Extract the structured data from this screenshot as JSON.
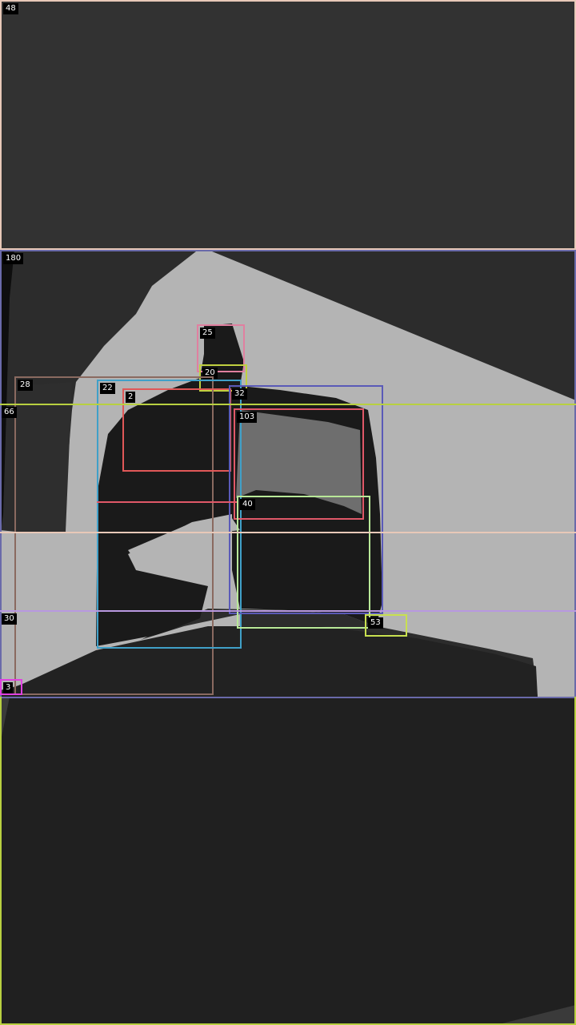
{
  "regions": [
    {
      "id": "48",
      "label": "48",
      "color": "#e8c8b8"
    },
    {
      "id": "180",
      "label": "180",
      "color": "#6a6aaa"
    },
    {
      "id": "25",
      "label": "25",
      "color": "#e080a0"
    },
    {
      "id": "20",
      "label": "20",
      "color": "#c0d040"
    },
    {
      "id": "28",
      "label": "28",
      "color": "#8a6a60"
    },
    {
      "id": "22",
      "label": "22",
      "color": "#40a0c8"
    },
    {
      "id": "2",
      "label": "2",
      "color": "#e05858"
    },
    {
      "id": "32",
      "label": "32",
      "color": "#5a5ab8"
    },
    {
      "id": "103",
      "label": "103",
      "color": "#e05868"
    },
    {
      "id": "66",
      "label": "66",
      "color": "#b8d040"
    },
    {
      "id": "40",
      "label": "40",
      "color": "#b8e898"
    },
    {
      "id": "53",
      "label": "53",
      "color": "#c8e050"
    },
    {
      "id": "30",
      "label": "30",
      "color": "#b898e0"
    },
    {
      "id": "3",
      "label": "3",
      "color": "#e040e0"
    }
  ],
  "colors": {
    "top_band": "#323232",
    "bottom_band": "#202020",
    "wall_light": "#b4b4b4",
    "shadow_dark": "#1a1a1a",
    "mid_gray": "#6e6e6e",
    "dark_gray": "#2e2e2e",
    "bottom_frame": "#b8d040",
    "line_665": "#e8c8b8",
    "line_626": "#e05868"
  }
}
